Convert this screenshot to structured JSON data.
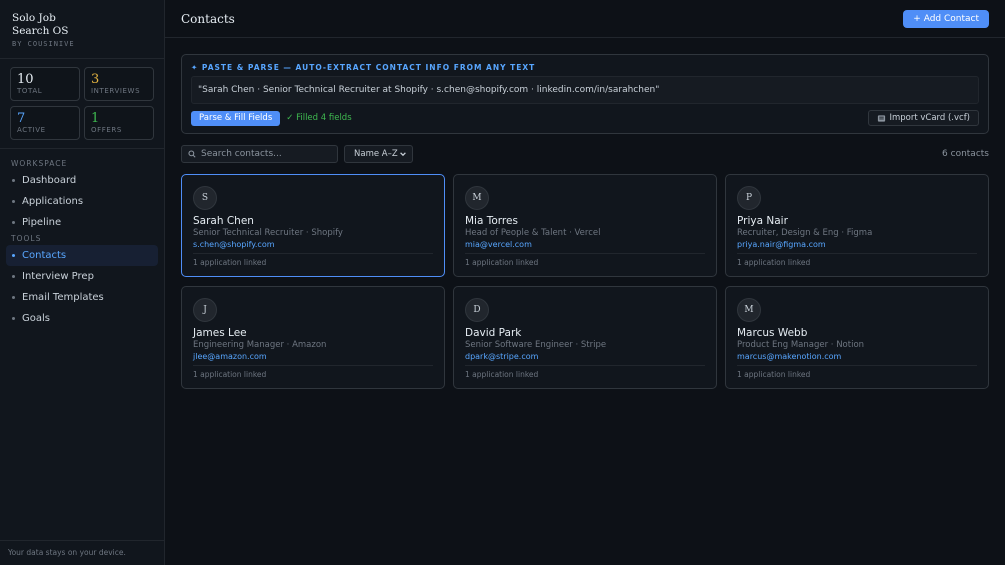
{
  "brand": {
    "title": "Solo Job Search OS",
    "subtitle": "BY COUSINIVE"
  },
  "stats": [
    {
      "value": "10",
      "label": "TOTAL",
      "color": "#e6edf3"
    },
    {
      "value": "3",
      "label": "INTERVIEWS",
      "color": "#e3b341"
    },
    {
      "value": "7",
      "label": "ACTIVE",
      "color": "#58a6ff"
    },
    {
      "value": "1",
      "label": "OFFERS",
      "color": "#3fb950"
    }
  ],
  "nav": {
    "workspace_label": "WORKSPACE",
    "workspace": [
      "Dashboard",
      "Applications",
      "Pipeline"
    ],
    "tools_label": "TOOLS",
    "tools": [
      "Contacts",
      "Interview Prep",
      "Email Templates",
      "Goals"
    ],
    "active": "Contacts"
  },
  "footer": "Your data stays on your device.",
  "header": {
    "title": "Contacts",
    "add_button": "+ Add Contact"
  },
  "parse": {
    "heading": "✦ PASTE & PARSE — AUTO-EXTRACT CONTACT INFO FROM ANY TEXT",
    "input_value": "\"Sarah Chen · Senior Technical Recruiter at Shopify · s.chen@shopify.com · linkedin.com/in/sarahchen\"",
    "button": "Parse & Fill Fields",
    "status": "✓ Filled 4 fields",
    "import_button": "Import vCard (.vcf)"
  },
  "toolbar": {
    "search_placeholder": "Search contacts...",
    "sort_value": "Name A–Z",
    "count": "6 contacts"
  },
  "contacts": [
    {
      "initial": "S",
      "name": "Sarah Chen",
      "role": "Senior Technical Recruiter · Shopify",
      "email": "s.chen@shopify.com",
      "linked": "1 application linked"
    },
    {
      "initial": "M",
      "name": "Mia Torres",
      "role": "Head of People & Talent · Vercel",
      "email": "mia@vercel.com",
      "linked": "1 application linked"
    },
    {
      "initial": "P",
      "name": "Priya Nair",
      "role": "Recruiter, Design & Eng · Figma",
      "email": "priya.nair@figma.com",
      "linked": "1 application linked"
    },
    {
      "initial": "J",
      "name": "James Lee",
      "role": "Engineering Manager · Amazon",
      "email": "jlee@amazon.com",
      "linked": "1 application linked"
    },
    {
      "initial": "D",
      "name": "David Park",
      "role": "Senior Software Engineer · Stripe",
      "email": "dpark@stripe.com",
      "linked": "1 application linked"
    },
    {
      "initial": "M",
      "name": "Marcus Webb",
      "role": "Product Eng Manager · Notion",
      "email": "marcus@makenotion.com",
      "linked": "1 application linked"
    }
  ],
  "selected_contact": "Sarah Chen",
  "colors": {
    "accent": "#4f8ef7",
    "link": "#58a6ff",
    "success": "#3fb950",
    "background": "#0d1117"
  }
}
